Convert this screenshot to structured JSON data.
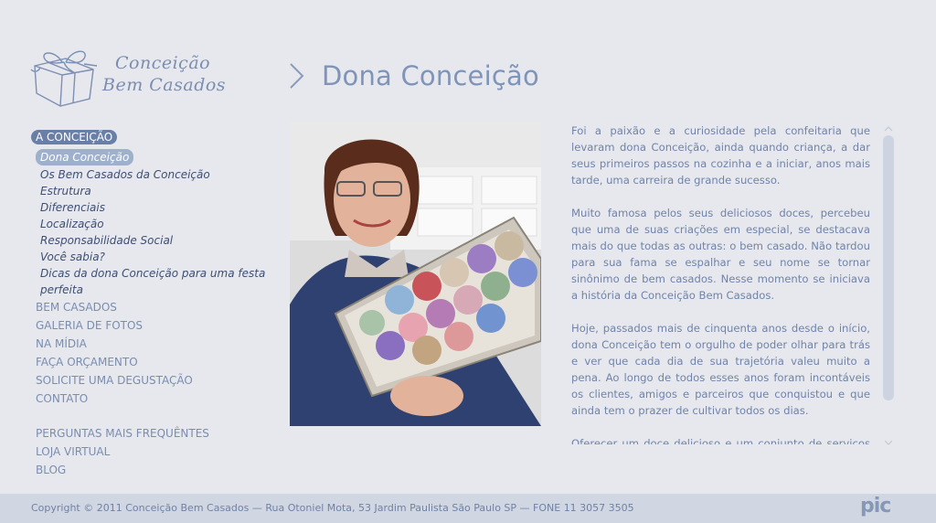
{
  "brand": {
    "line1": "Conceição",
    "line2": "Bem Casados"
  },
  "page": {
    "title": "Dona Conceição"
  },
  "nav": {
    "section": "A CONCEIÇÃO",
    "sub_items": [
      "Dona Conceição",
      "Os Bem Casados da Conceição",
      "Estrutura",
      "Diferenciais",
      "Localização",
      "Responsabilidade Social",
      "Você sabia?",
      "Dicas da dona Conceição para uma festa",
      "perfeita"
    ],
    "main_items": [
      "BEM CASADOS",
      "GALERIA DE FOTOS",
      "NA MÍDIA",
      "FAÇA ORÇAMENTO",
      "SOLICITE UMA DEGUSTAÇÃO",
      "CONTATO"
    ],
    "extra_items": [
      "PERGUNTAS MAIS FREQUÊNTES",
      "LOJA VIRTUAL",
      "BLOG"
    ]
  },
  "content": {
    "paragraphs": [
      "Foi a paixão e a curiosidade pela confeitaria que levaram dona Conceição, ainda quando criança, a dar seus primeiros passos na cozinha e a iniciar, anos mais tarde, uma carreira de grande sucesso.",
      "Muito famosa pelos seus deliciosos doces, percebeu que uma de suas criações em especial, se destacava mais do que todas as outras: o bem casado. Não tardou para sua fama se espalhar e seu nome se tornar sinônimo de bem casados. Nesse momento se iniciava a história da Conceição Bem Casados.",
      "Hoje, passados mais de cinquenta anos desde o início, dona Conceição tem o orgulho de poder olhar para trás e ver que cada dia de sua trajetória valeu muito a pena. Ao longo de todos esses anos foram incontáveis os clientes, amigos e parceiros que conquistou e que ainda tem o prazer de cultivar todos os dias.",
      "Oferecer um doce delicioso e um conjunto de serviços sempre acima das expectativas de seus clientes foi o que"
    ]
  },
  "footer": {
    "copyright": "Copyright © 2011 Conceição Bem Casados — Rua Otoniel Mota, 53 Jardim Paulista São Paulo SP — FONE 11 3057 3505",
    "agency": "pic"
  },
  "colors": {
    "background": "#e6e8ee",
    "accent": "#6a7fa6",
    "text": "#7083aa",
    "footer_bg": "#d0d6e2"
  }
}
